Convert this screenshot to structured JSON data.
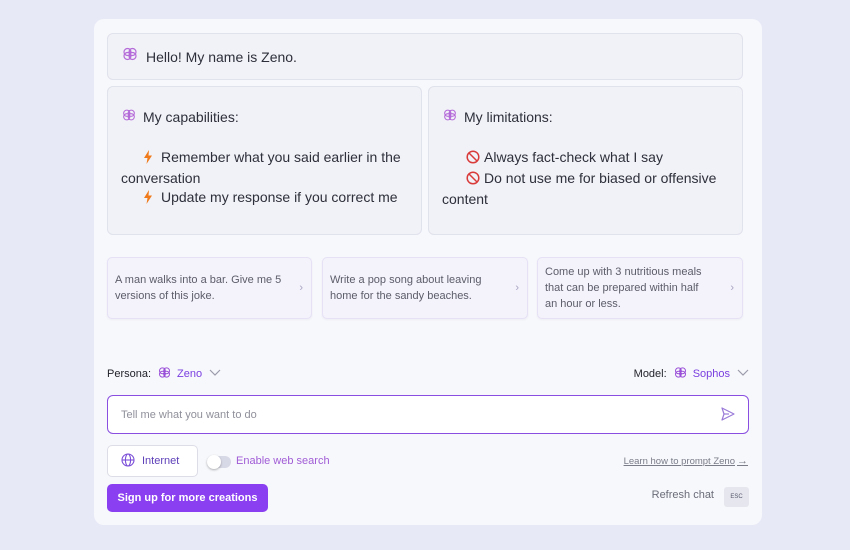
{
  "greeting": {
    "text": "Hello! My name is Zeno."
  },
  "capabilities": {
    "title": "My capabilities:",
    "items": [
      "Remember what you said earlier in the",
      "conversation",
      "Update my response if you correct me"
    ]
  },
  "limitations": {
    "title": "My limitations:",
    "items": [
      "Always fact-check what I say",
      "Do not use me for biased or offensive",
      "content"
    ]
  },
  "suggestions": [
    {
      "line1": "A man walks into a bar. Give me 5",
      "line2": "versions of this joke."
    },
    {
      "line1": "Write a pop song about leaving",
      "line2": "home for the sandy beaches."
    },
    {
      "line1": "Come up with 3 nutritious meals",
      "line2": "that can be prepared within half",
      "line3": "an hour or less."
    }
  ],
  "persona": {
    "label": "Persona:",
    "value": "Zeno"
  },
  "model": {
    "label": "Model:",
    "value": "Sophos"
  },
  "prompt": {
    "placeholder": "Tell me what you want to do"
  },
  "internet": {
    "label": "Internet"
  },
  "web_search": {
    "label": "Enable web search",
    "enabled": false
  },
  "learn_link": {
    "label": "Learn how to prompt Zeno"
  },
  "signup": {
    "label": "Sign up for more creations"
  },
  "refresh": {
    "label": "Refresh chat",
    "shortcut": "ESC"
  },
  "colors": {
    "accent": "#8a3ff0",
    "bolt": "#f07a1a",
    "ban": "#d93a3a"
  }
}
